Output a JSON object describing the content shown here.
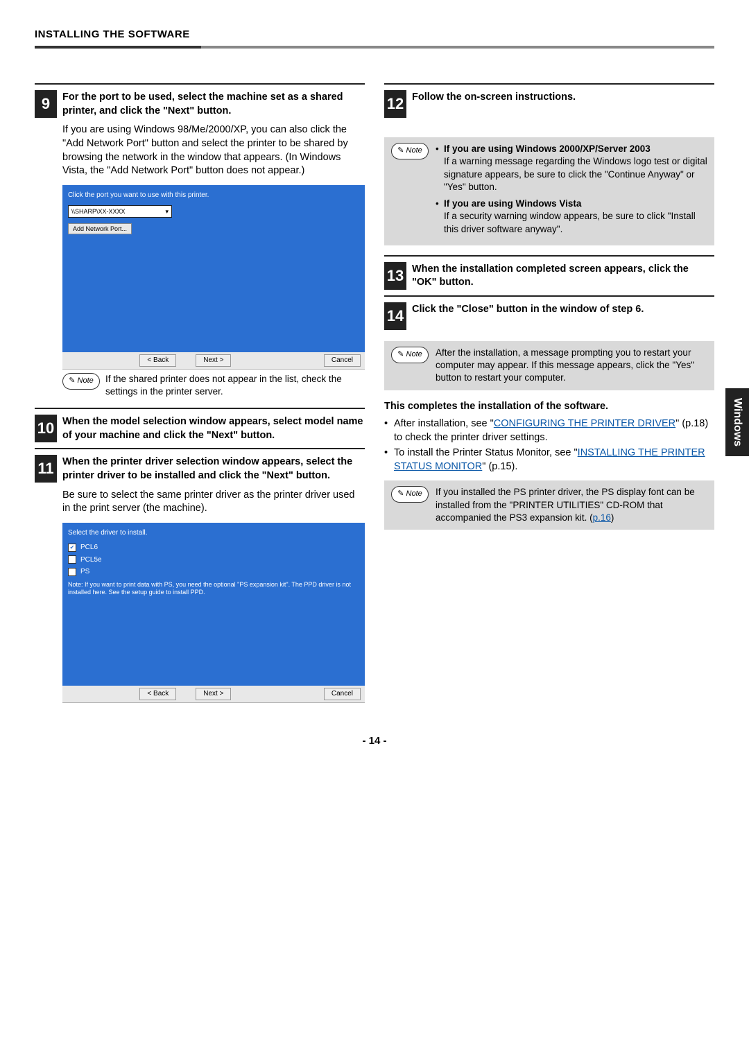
{
  "header": {
    "title": "INSTALLING THE SOFTWARE"
  },
  "side_tab": "Windows",
  "page_number": "- 14 -",
  "left": {
    "step9": {
      "num": "9",
      "title": "For the port to be used, select the machine set as a shared printer, and click the \"Next\" button.",
      "body": "If you are using Windows 98/Me/2000/XP, you can also click the \"Add Network Port\" button and select the printer to be shared by browsing the network in the window that appears. (In Windows Vista, the \"Add Network Port\" button does not appear.)",
      "panel": {
        "instr": "Click the port you want to use with this printer.",
        "input_value": "\\\\SHARP\\XX-XXXX",
        "dropdown_icon": "▾",
        "add_port_btn": "Add Network Port...",
        "back": "< Back",
        "next": "Next >",
        "cancel": "Cancel"
      },
      "note": "If the shared printer does not appear in the list, check the settings in the printer server."
    },
    "step10": {
      "num": "10",
      "title": "When the model selection window appears, select model name of your machine and click the \"Next\" button."
    },
    "step11": {
      "num": "11",
      "title": "When the printer driver selection window appears, select the printer driver to be installed and click the \"Next\" button.",
      "body": "Be sure to select the same printer driver as the printer driver used in the print server (the machine).",
      "panel": {
        "instr": "Select the driver to install.",
        "opt1": "PCL6",
        "opt2": "PCL5e",
        "opt3": "PS",
        "warn": "Note: If you want to print data with PS, you need the optional \"PS expansion kit\". The PPD driver is not installed here. See the setup guide to install PPD.",
        "back": "< Back",
        "next": "Next >",
        "cancel": "Cancel"
      }
    }
  },
  "right": {
    "step12": {
      "num": "12",
      "title": "Follow the on-screen instructions."
    },
    "note12": {
      "line1_b": "If you are using Windows 2000/XP/Server 2003",
      "line1": "If a warning message regarding the Windows logo test or digital signature appears, be sure to click the \"Continue Anyway\" or \"Yes\" button.",
      "line2_b": "If you are using Windows Vista",
      "line2": "If a security warning window appears, be sure to click \"Install this driver software anyway\"."
    },
    "step13": {
      "num": "13",
      "title": "When the installation completed screen appears, click the \"OK\" button."
    },
    "step14": {
      "num": "14",
      "title": "Click the \"Close\" button in the window of step 6."
    },
    "note14": "After the installation, a message prompting you to restart your computer may appear. If this message appears, click the \"Yes\" button to restart your computer.",
    "completion": "This completes the installation of the software.",
    "bullet1_pre": "After installation, see \"",
    "bullet1_link": "CONFIGURING THE PRINTER DRIVER",
    "bullet1_post": "\" (p.18) to check the printer driver settings.",
    "bullet2_pre": "To install the Printer Status Monitor, see \"",
    "bullet2_link": "INSTALLING THE PRINTER STATUS MONITOR",
    "bullet2_post": "\" (p.15).",
    "note_final_pre": "If you installed the PS printer driver, the PS display font can be installed from the \"PRINTER UTILITIES\" CD-ROM that accompanied the PS3 expansion kit. (",
    "note_final_link": "p.16",
    "note_final_post": ")",
    "note_label": "Note"
  }
}
